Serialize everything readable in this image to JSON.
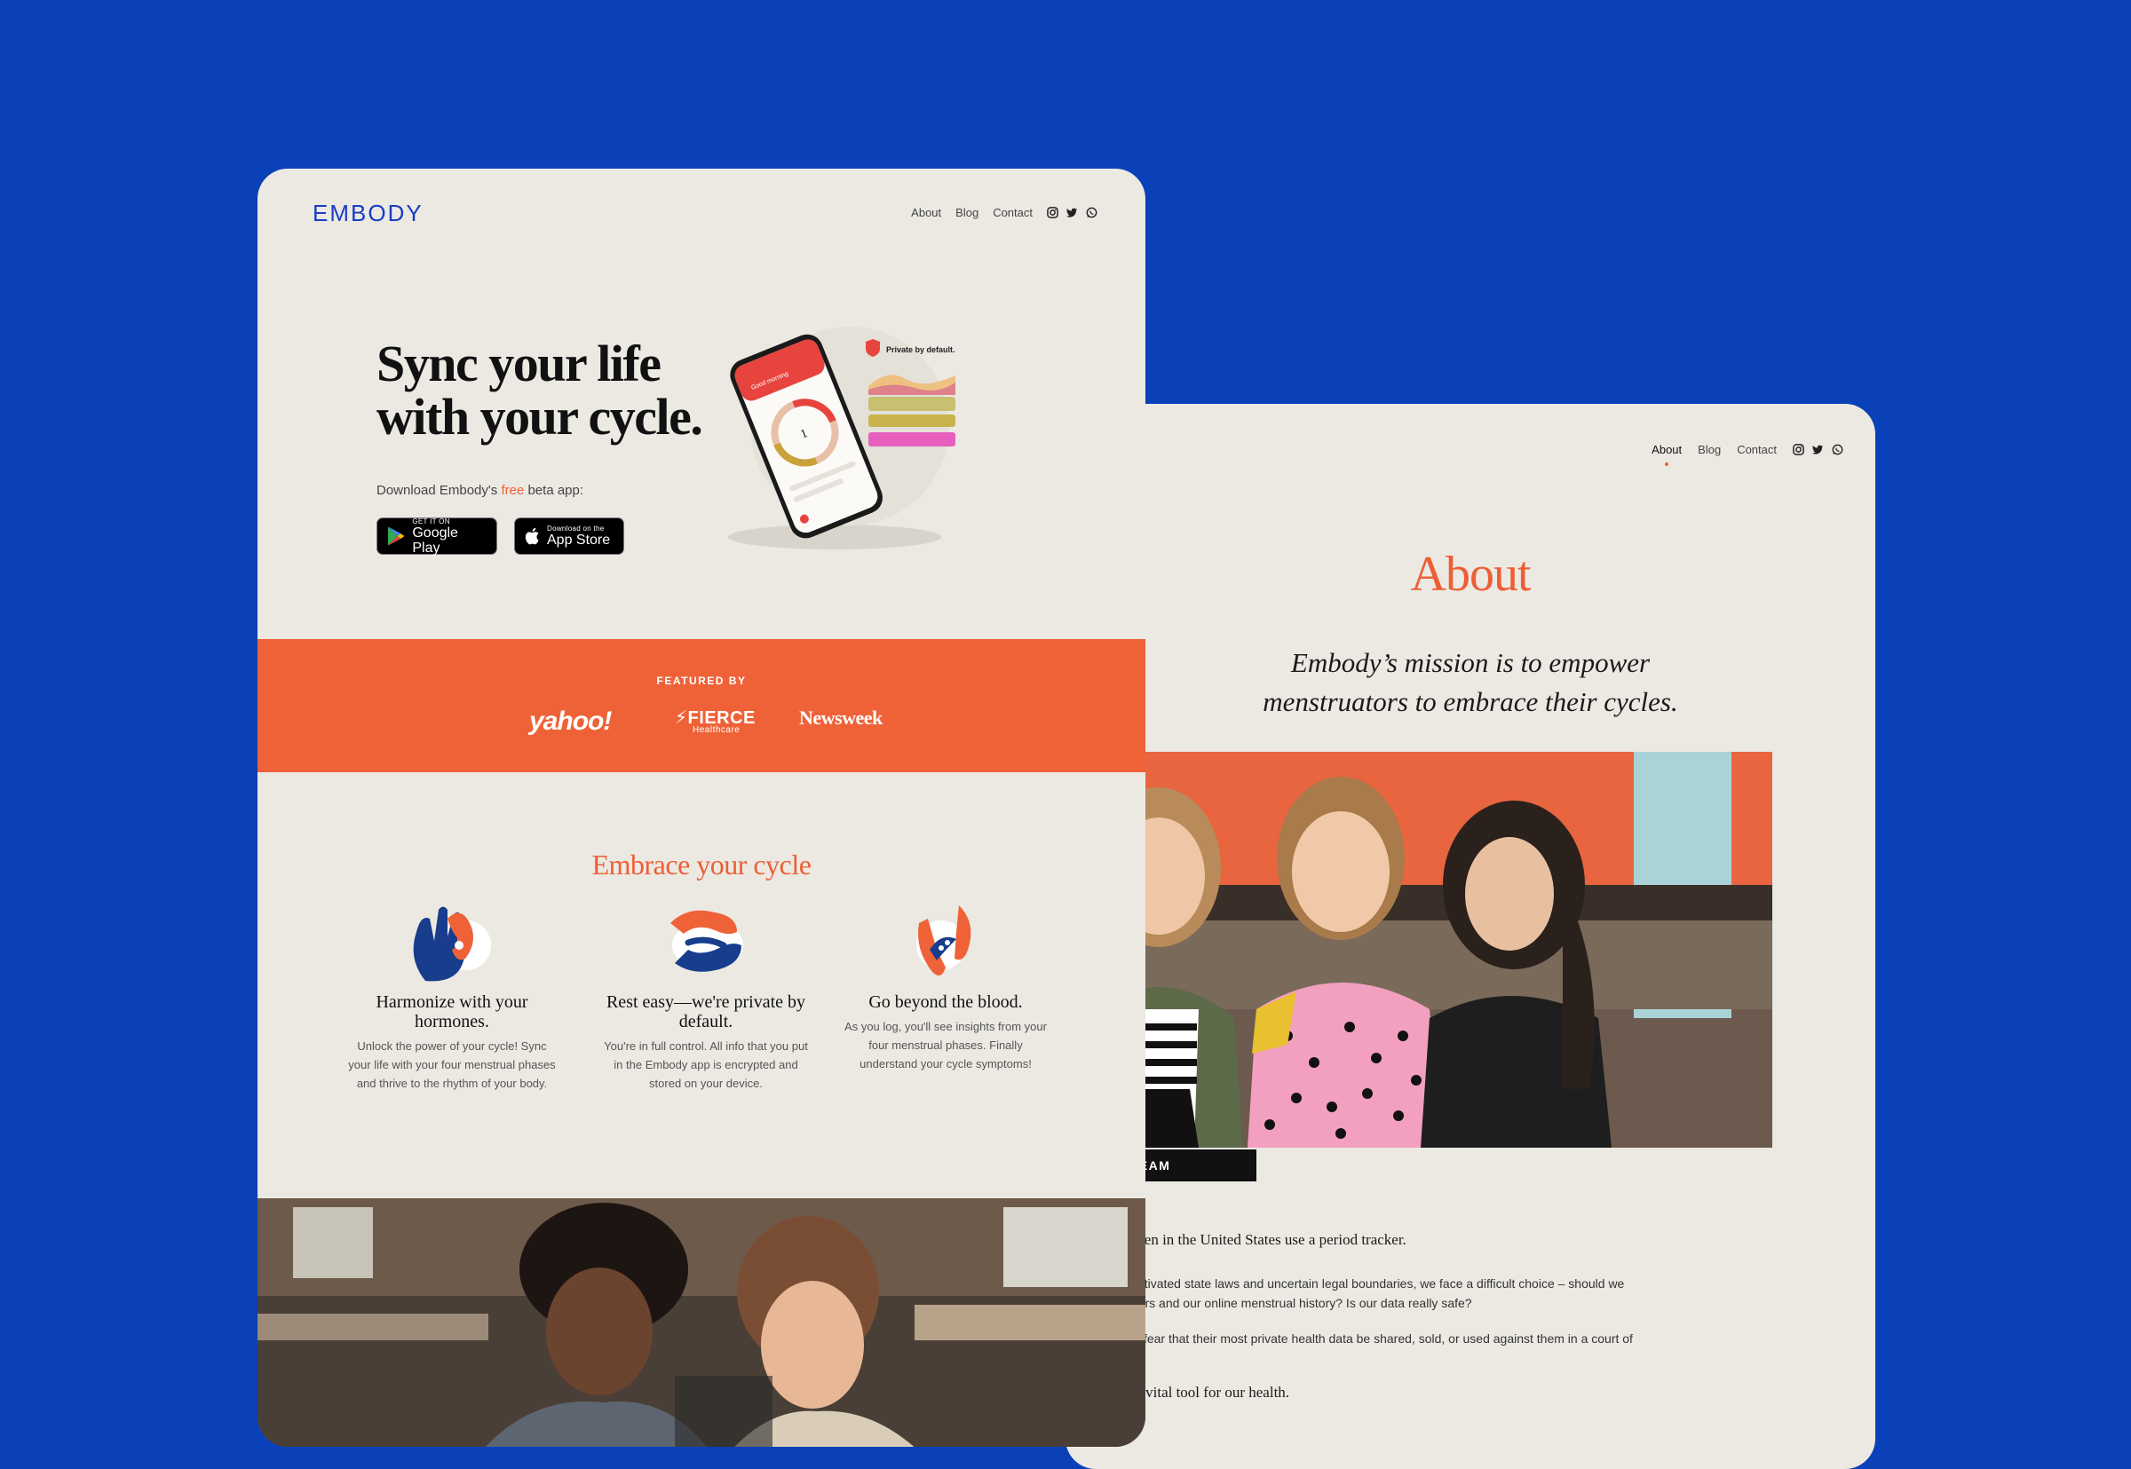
{
  "about_page": {
    "nav": {
      "items": [
        {
          "label": "About",
          "active": true
        },
        {
          "label": "Blog",
          "active": false
        },
        {
          "label": "Contact",
          "active": false
        }
      ],
      "social_icons": [
        "instagram-icon",
        "twitter-icon",
        "whatsapp-icon"
      ]
    },
    "title": "About",
    "mission_line1": "Embody’s mission is to empower",
    "mission_line2": "menstruators to embrace their cycles.",
    "photo_caption": "MBODY TEAM",
    "body": {
      "lead": "third of women in the United States use a period tracker.",
      "p1_line1": "ke of newly activated state laws and uncertain legal boundaries, we face a difficult choice – should we",
      "p1_line2": "r period trackers and our online menstrual history? Is our data really safe?",
      "p2_line1": "hould have to fear that their most private health data be shared, sold, or used against them in a court of",
      "lead2": "rackers are a vital tool for our health."
    }
  },
  "home_page": {
    "logo": "EMBODY",
    "nav": {
      "items": [
        {
          "label": "About"
        },
        {
          "label": "Blog"
        },
        {
          "label": "Contact"
        }
      ],
      "social_icons": [
        "instagram-icon",
        "twitter-icon",
        "whatsapp-icon"
      ]
    },
    "hero": {
      "line1": "Sync your life",
      "line2": "with your cycle.",
      "download_prefix": "Download Embody's ",
      "download_free": "free",
      "download_suffix": " beta app:",
      "google_play": {
        "small": "GET IT ON",
        "big": "Google Play"
      },
      "app_store": {
        "small": "Download on the",
        "big": "App Store"
      },
      "phone_badge": "Private by default.",
      "phone_greeting": "Good morning"
    },
    "featured": {
      "label": "FEATURED BY",
      "outlets": [
        "yahoo!",
        "FIERCE",
        "Healthcare",
        "Newsweek"
      ]
    },
    "embrace_title": "Embrace your cycle",
    "features": [
      {
        "title": "Harmonize with your hormones.",
        "desc": "Unlock the power of your cycle! Sync your life with your four menstrual phases and thrive to the rhythm of your body."
      },
      {
        "title": "Rest easy—we're private by default.",
        "desc": "You're in full control. All info that you put in the Embody app is encrypted and stored on your device."
      },
      {
        "title": "Go beyond the blood.",
        "desc": "As you log, you'll see insights from your four menstrual phases. Finally understand your cycle symptoms!"
      }
    ]
  },
  "colors": {
    "background": "#0a40b8",
    "accent": "#ef6238",
    "page": "#ebe9e2",
    "brand_blue": "#1a3cc8"
  }
}
